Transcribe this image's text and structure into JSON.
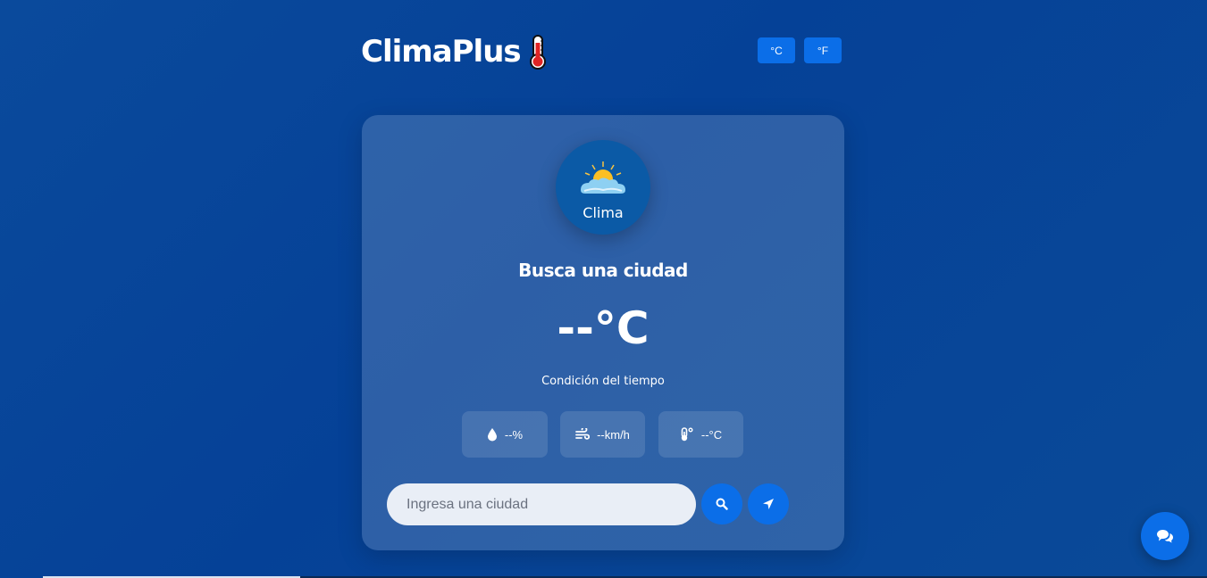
{
  "header": {
    "app_title": "ClimaPlus",
    "title_icon": "thermometer-icon",
    "unit_celsius_label": "°C",
    "unit_fahrenheit_label": "°F"
  },
  "weather_card": {
    "logo_text": "Clima",
    "logo_icon": "sun-behind-cloud-icon",
    "city_name": "Busca una ciudad",
    "temperature": "--°C",
    "condition": "Condición del tiempo",
    "stats": {
      "humidity": {
        "icon": "water-drop-icon",
        "value": "--%"
      },
      "wind": {
        "icon": "wind-icon",
        "value": "--km/h"
      },
      "feels_like": {
        "icon": "temperature-icon",
        "value": "--°C"
      }
    },
    "search": {
      "placeholder": "Ingresa una ciudad",
      "value": "",
      "search_icon": "search-icon",
      "location_icon": "location-arrow-icon"
    }
  },
  "chat": {
    "icon": "chat-bubbles-icon"
  },
  "colors": {
    "background": "#054197",
    "accent": "#0b6ee8",
    "card": "rgba(255,255,255,0.16)"
  }
}
